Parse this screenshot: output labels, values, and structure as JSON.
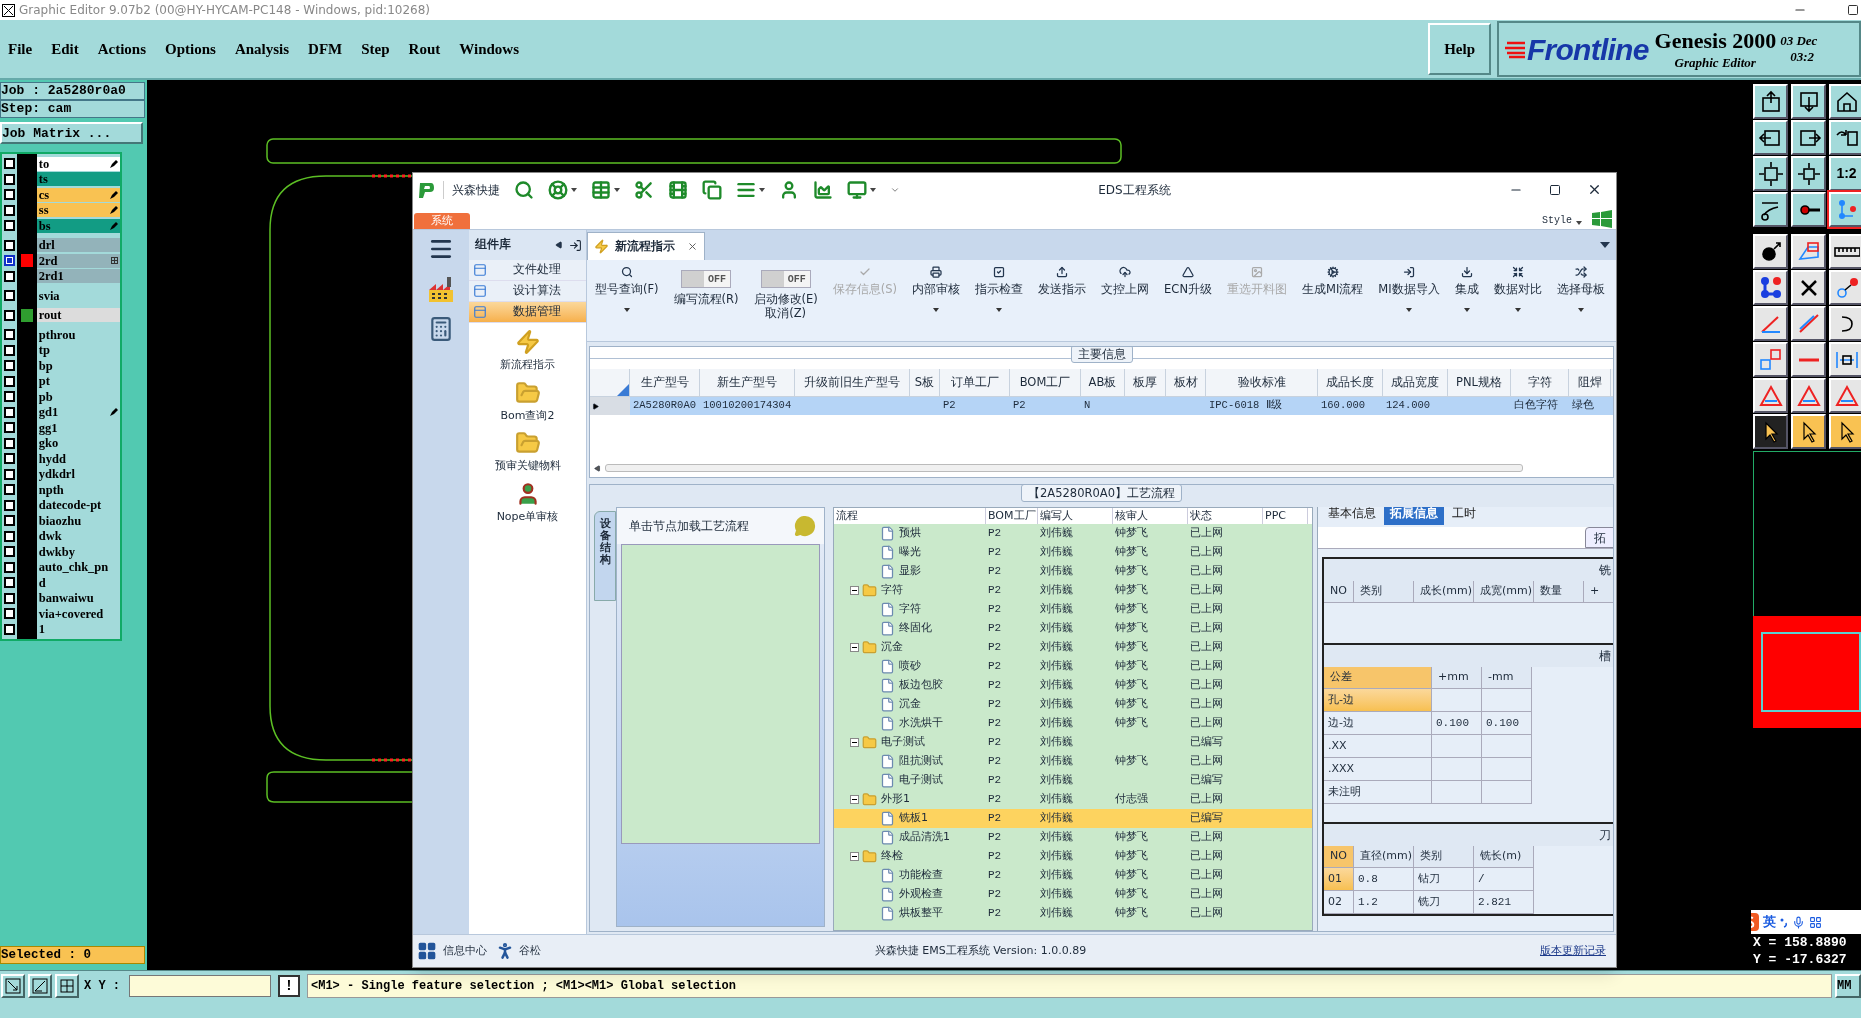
{
  "window": {
    "title": "Graphic Editor 9.07b2 (00@HY-HYCAM-PC148 - Windows, pid:10268)"
  },
  "menu": [
    "File",
    "Edit",
    "Actions",
    "Options",
    "Analysis",
    "DFM",
    "Step",
    "Rout",
    "Windows"
  ],
  "help": "Help",
  "brand": {
    "logo": "Frontline",
    "product": "Genesis 2000",
    "subtitle": "Graphic Editor",
    "date": "03 Dec",
    "time": "03:2"
  },
  "job": {
    "job": "Job : 2a5280r0a0",
    "step": "Step: cam",
    "matrix": "Job Matrix ..."
  },
  "layer_groups": [
    [
      {
        "name": "to",
        "kind": "silk",
        "selected": false,
        "editable": true,
        "linked": false
      },
      {
        "name": "ts",
        "kind": "mask",
        "selected": false,
        "editable": false,
        "linked": false
      },
      {
        "name": "cs",
        "kind": "signal",
        "selected": false,
        "editable": true,
        "linked": false
      },
      {
        "name": "ss",
        "kind": "signal",
        "selected": false,
        "editable": true,
        "linked": false
      },
      {
        "name": "bs",
        "kind": "mask",
        "selected": false,
        "editable": true,
        "linked": false
      }
    ],
    [
      {
        "name": "drl",
        "kind": "drill",
        "selected": false,
        "editable": false,
        "linked": false
      },
      {
        "name": "2rd",
        "kind": "drill",
        "color": "#ff0000",
        "selected": true,
        "editable": false,
        "linked": true
      },
      {
        "name": "2rd1",
        "kind": "drill",
        "selected": false,
        "editable": false,
        "linked": false
      }
    ],
    [
      {
        "name": "svia",
        "kind": "document",
        "selected": false,
        "editable": false,
        "linked": false
      }
    ],
    [
      {
        "name": "rout",
        "kind": "rout",
        "color": "#2f9e2f",
        "selected": false,
        "editable": false,
        "linked": false
      }
    ],
    [
      {
        "name": "pthrou",
        "kind": "document",
        "selected": false,
        "editable": false,
        "linked": false
      },
      {
        "name": "tp",
        "kind": "document",
        "selected": false,
        "editable": false,
        "linked": false
      },
      {
        "name": "bp",
        "kind": "document",
        "selected": false,
        "editable": false,
        "linked": false
      },
      {
        "name": "pt",
        "kind": "document",
        "selected": false,
        "editable": false,
        "linked": false
      },
      {
        "name": "pb",
        "kind": "document",
        "selected": false,
        "editable": false,
        "linked": false
      },
      {
        "name": "gd1",
        "kind": "document",
        "selected": false,
        "editable": true,
        "linked": false
      },
      {
        "name": "gg1",
        "kind": "document",
        "selected": false,
        "editable": false,
        "linked": false
      },
      {
        "name": "gko",
        "kind": "document",
        "selected": false,
        "editable": false,
        "linked": false
      },
      {
        "name": "hydd",
        "kind": "document",
        "selected": false,
        "editable": false,
        "linked": false
      },
      {
        "name": "ydkdrl",
        "kind": "document",
        "selected": false,
        "editable": false,
        "linked": false
      },
      {
        "name": "npth",
        "kind": "document",
        "selected": false,
        "editable": false,
        "linked": false
      },
      {
        "name": "datecode-pt",
        "kind": "document",
        "selected": false,
        "editable": false,
        "linked": false
      },
      {
        "name": "biaozhu",
        "kind": "document",
        "selected": false,
        "editable": false,
        "linked": false
      },
      {
        "name": "dwk",
        "kind": "document",
        "selected": false,
        "editable": false,
        "linked": false
      },
      {
        "name": "dwkby",
        "kind": "document",
        "selected": false,
        "editable": false,
        "linked": false
      },
      {
        "name": "auto_chk_pn",
        "kind": "document",
        "selected": false,
        "editable": false,
        "linked": false
      },
      {
        "name": "d",
        "kind": "document",
        "selected": false,
        "editable": false,
        "linked": false
      },
      {
        "name": "banwaiwu",
        "kind": "document",
        "selected": false,
        "editable": false,
        "linked": false
      },
      {
        "name": "via+covered",
        "kind": "document",
        "selected": false,
        "editable": false,
        "linked": false
      },
      {
        "name": "1",
        "kind": "document",
        "selected": false,
        "editable": false,
        "linked": false
      }
    ]
  ],
  "selected_count": "Selected : 0",
  "toolbar_ratio": "1:2",
  "ime": {
    "lang": "英"
  },
  "coords": {
    "x": "X = 158.8890",
    "y": "Y = -17.6327"
  },
  "status": {
    "xy_label": "X Y :",
    "alert": "!",
    "message": "<M1> - Single feature selection ; <M1><M1> Global selection",
    "units": "MM"
  },
  "eds": {
    "brand": "兴森快捷",
    "title": "EDS工程系统",
    "system_tab": "系统",
    "style": "Style",
    "panel_title": "组件库",
    "categories": [
      {
        "label": "文件处理",
        "selected": false
      },
      {
        "label": "设计算法",
        "selected": false
      },
      {
        "label": "数据管理",
        "selected": true
      }
    ],
    "tools": [
      {
        "label": "新流程指示",
        "kind": "bolt"
      },
      {
        "label": "Bom查询2",
        "kind": "folder"
      },
      {
        "label": "预审关键物料",
        "kind": "folder"
      },
      {
        "label": "Nope单审核",
        "kind": "person"
      }
    ],
    "doc_tab": "新流程指示",
    "ribbon": [
      {
        "kind": "button",
        "label": "型号查询(F)",
        "disabled": false,
        "dropdown": true
      },
      {
        "kind": "toggle",
        "label": "编写流程(R)",
        "state": "OFF",
        "on": false,
        "disabled": false
      },
      {
        "kind": "toggle",
        "label": "启动修改(E)\n取消(Z)",
        "state": "OFF",
        "on": false,
        "disabled": false
      },
      {
        "kind": "button",
        "label": "保存信息(S)",
        "disabled": true,
        "dropdown": false
      },
      {
        "kind": "button",
        "label": "内部审核",
        "disabled": false,
        "dropdown": true
      },
      {
        "kind": "button",
        "label": "指示检查",
        "disabled": false,
        "dropdown": true
      },
      {
        "kind": "button",
        "label": "发送指示",
        "disabled": false,
        "dropdown": false
      },
      {
        "kind": "button",
        "label": "文控上网",
        "disabled": false,
        "dropdown": false
      },
      {
        "kind": "button",
        "label": "ECN升级",
        "disabled": false,
        "dropdown": false
      },
      {
        "kind": "button",
        "label": "重选开料图",
        "disabled": true,
        "dropdown": false
      },
      {
        "kind": "button",
        "label": "生成MI流程",
        "disabled": false,
        "dropdown": false
      },
      {
        "kind": "button",
        "label": "MI数据导入",
        "disabled": false,
        "dropdown": true
      },
      {
        "kind": "button",
        "label": "集成",
        "disabled": false,
        "dropdown": true
      },
      {
        "kind": "button",
        "label": "数据对比",
        "disabled": false,
        "dropdown": true
      },
      {
        "kind": "button",
        "label": "选择母板",
        "disabled": false,
        "dropdown": true
      }
    ],
    "main_info": {
      "title": "主要信息",
      "columns": [
        "生产型号",
        "新生产型号",
        "升级前旧生产型号",
        "S板",
        "订单工厂",
        "BOM工厂",
        "AB板",
        "板厚",
        "板材",
        "验收标准",
        "成品长度",
        "成品宽度",
        "PNL规格",
        "字符",
        "阻焊"
      ],
      "rows": [
        {
          "selected": true,
          "cells": [
            "2A5280R0A0",
            "10010200174304",
            null,
            null,
            "P2",
            "P2",
            "N",
            null,
            null,
            "IPC-6018 Ⅱ级",
            "160.000",
            "124.000",
            null,
            "白色字符",
            "绿色"
          ]
        }
      ]
    },
    "flow": {
      "title": "【2A5280R0A0】工艺流程",
      "side_tab": "设备结构",
      "hint": "单击节点加载工艺流程",
      "columns": [
        "流程",
        "BOM工厂",
        "编写人",
        "核审人",
        "状态",
        "PPC"
      ],
      "tree": [
        {
          "children": [
            {
              "label": "预烘",
              "bom": "P2",
              "writer": "刘伟巍",
              "reviewer": "钟梦飞",
              "status": "已上网",
              "selected": false
            },
            {
              "label": "曝光",
              "bom": "P2",
              "writer": "刘伟巍",
              "reviewer": "钟梦飞",
              "status": "已上网",
              "selected": false
            },
            {
              "label": "显影",
              "bom": "P2",
              "writer": "刘伟巍",
              "reviewer": "钟梦飞",
              "status": "已上网",
              "selected": false
            }
          ]
        },
        {
          "label": "字符",
          "bom": "P2",
          "writer": "刘伟巍",
          "reviewer": "钟梦飞",
          "status": "已上网",
          "selected": false,
          "expanded": true,
          "children": [
            {
              "label": "字符",
              "bom": "P2",
              "writer": "刘伟巍",
              "reviewer": "钟梦飞",
              "status": "已上网",
              "selected": false
            },
            {
              "label": "终固化",
              "bom": "P2",
              "writer": "刘伟巍",
              "reviewer": "钟梦飞",
              "status": "已上网",
              "selected": false
            }
          ]
        },
        {
          "label": "沉金",
          "bom": "P2",
          "writer": "刘伟巍",
          "reviewer": "钟梦飞",
          "status": "已上网",
          "selected": false,
          "expanded": true,
          "children": [
            {
              "label": "喷砂",
              "bom": "P2",
              "writer": "刘伟巍",
              "reviewer": "钟梦飞",
              "status": "已上网",
              "selected": false
            },
            {
              "label": "板边包胶",
              "bom": "P2",
              "writer": "刘伟巍",
              "reviewer": "钟梦飞",
              "status": "已上网",
              "selected": false
            },
            {
              "label": "沉金",
              "bom": "P2",
              "writer": "刘伟巍",
              "reviewer": "钟梦飞",
              "status": "已上网",
              "selected": false
            },
            {
              "label": "水洗烘干",
              "bom": "P2",
              "writer": "刘伟巍",
              "reviewer": "钟梦飞",
              "status": "已上网",
              "selected": false
            }
          ]
        },
        {
          "label": "电子测试",
          "bom": "P2",
          "writer": "刘伟巍",
          "status": "已编写",
          "selected": false,
          "expanded": true,
          "children": [
            {
              "label": "阻抗测试",
              "bom": "P2",
              "writer": "刘伟巍",
              "reviewer": "钟梦飞",
              "status": "已上网",
              "selected": false
            },
            {
              "label": "电子测试",
              "bom": "P2",
              "writer": "刘伟巍",
              "status": "已编写",
              "selected": false
            }
          ]
        },
        {
          "label": "外形1",
          "bom": "P2",
          "writer": "刘伟巍",
          "reviewer": "付志强",
          "status": "已上网",
          "selected": false,
          "expanded": true,
          "children": [
            {
              "label": "铣板1",
              "bom": "P2",
              "writer": "刘伟巍",
              "status": "已编写",
              "selected": true
            },
            {
              "label": "成品清洗1",
              "bom": "P2",
              "writer": "刘伟巍",
              "reviewer": "钟梦飞",
              "status": "已上网",
              "selected": false
            }
          ]
        },
        {
          "label": "终检",
          "bom": "P2",
          "writer": "刘伟巍",
          "reviewer": "钟梦飞",
          "status": "已上网",
          "selected": false,
          "expanded": true,
          "children": [
            {
              "label": "功能检查",
              "bom": "P2",
              "writer": "刘伟巍",
              "reviewer": "钟梦飞",
              "status": "已上网",
              "selected": false
            },
            {
              "label": "外观检查",
              "bom": "P2",
              "writer": "刘伟巍",
              "reviewer": "钟梦飞",
              "status": "已上网",
              "selected": false
            },
            {
              "label": "烘板整平",
              "bom": "P2",
              "writer": "刘伟巍",
              "reviewer": "钟梦飞",
              "status": "已上网",
              "selected": false
            }
          ]
        }
      ]
    },
    "ext": {
      "tabs": [
        {
          "label": "基本信息",
          "selected": false
        },
        {
          "label": "拓展信息",
          "selected": true
        },
        {
          "label": "工时",
          "selected": false
        }
      ],
      "sub_button": "拓",
      "mill": {
        "title": "铣",
        "columns": [
          "NO",
          "类别",
          "成长(mm)",
          "成宽(mm)",
          "数量",
          "+"
        ]
      },
      "tolerance": {
        "title": "槽",
        "columns": [
          "公差",
          "+mm",
          "-mm"
        ],
        "rows": [
          {
            "cells": [
              "孔-边",
              null,
              null
            ],
            "selected": true
          },
          {
            "cells": [
              "边-边",
              "0.100",
              "0.100"
            ],
            "selected": false
          },
          {
            "cells": [
              ".XX",
              null,
              null
            ],
            "selected": false
          },
          {
            "cells": [
              ".XXX",
              null,
              null
            ],
            "selected": false
          },
          {
            "cells": [
              "未注明",
              null,
              null
            ],
            "selected": false
          }
        ]
      },
      "cutters": {
        "title": "刀",
        "columns": [
          "NO",
          "直径(mm)",
          "类别",
          "铣长(m)"
        ],
        "rows": [
          {
            "cells": [
              "01",
              "0.8",
              "钻刀",
              "/"
            ],
            "selected": true
          },
          {
            "cells": [
              "02",
              "1.2",
              "铣刀",
              "2.821"
            ],
            "selected": false
          }
        ]
      }
    },
    "footer": {
      "info_center": "信息中心",
      "user": "谷松",
      "version": "兴森快捷 EMS工程系统 Version: 1.0.0.89",
      "changelog": "版本更新记录"
    }
  }
}
